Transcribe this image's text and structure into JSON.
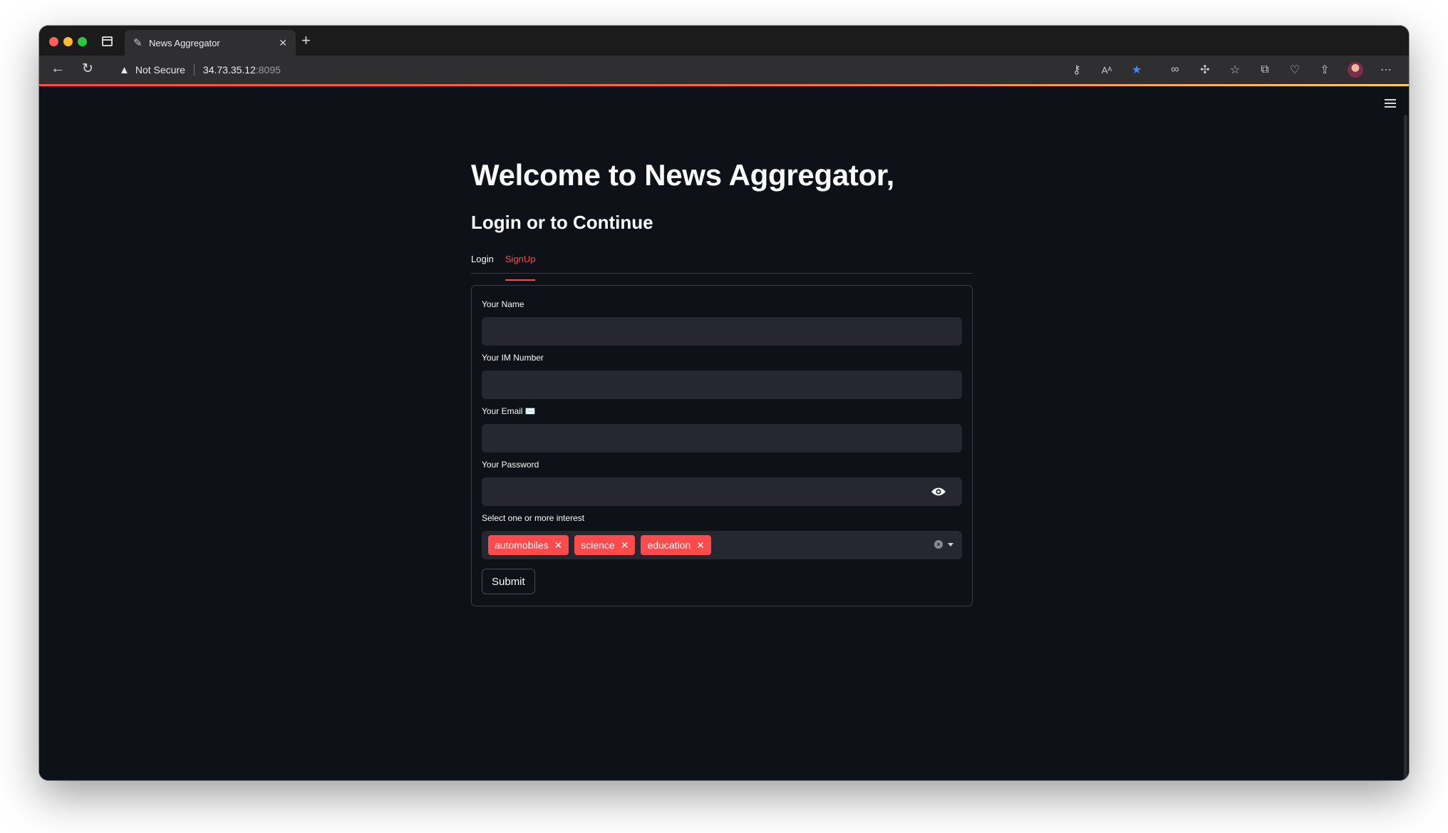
{
  "browser": {
    "tab_title": "News Aggregator",
    "favicon": "feather-icon",
    "security_label": "Not Secure",
    "url_host": "34.73.35.12",
    "url_port": ":8095",
    "toolbar_icons": [
      "key-icon",
      "read-aloud-icon",
      "favorite-star-icon",
      "extension-glasses-icon",
      "extensions-icon",
      "favorites-icon",
      "collections-icon",
      "performance-icon",
      "share-icon",
      "profile-avatar",
      "more-icon"
    ]
  },
  "page": {
    "title": "Welcome to News Aggregator,",
    "subtitle": "Login or to Continue",
    "tabs": [
      {
        "label": "Login",
        "active": false
      },
      {
        "label": "SignUp",
        "active": true
      }
    ],
    "form": {
      "name_label": "Your Name",
      "name_value": "",
      "im_label": "Your IM Number",
      "im_value": "",
      "email_label": "Your Email ✉️",
      "email_value": "",
      "password_label": "Your Password",
      "password_value": "",
      "interest_label": "Select one or more interest",
      "interests_selected": [
        "automobiles",
        "science",
        "education"
      ],
      "submit_label": "Submit"
    }
  },
  "colors": {
    "accent": "#ff4b4b",
    "background": "#0e1117",
    "input_bg": "#262730",
    "text": "#fafafa"
  }
}
